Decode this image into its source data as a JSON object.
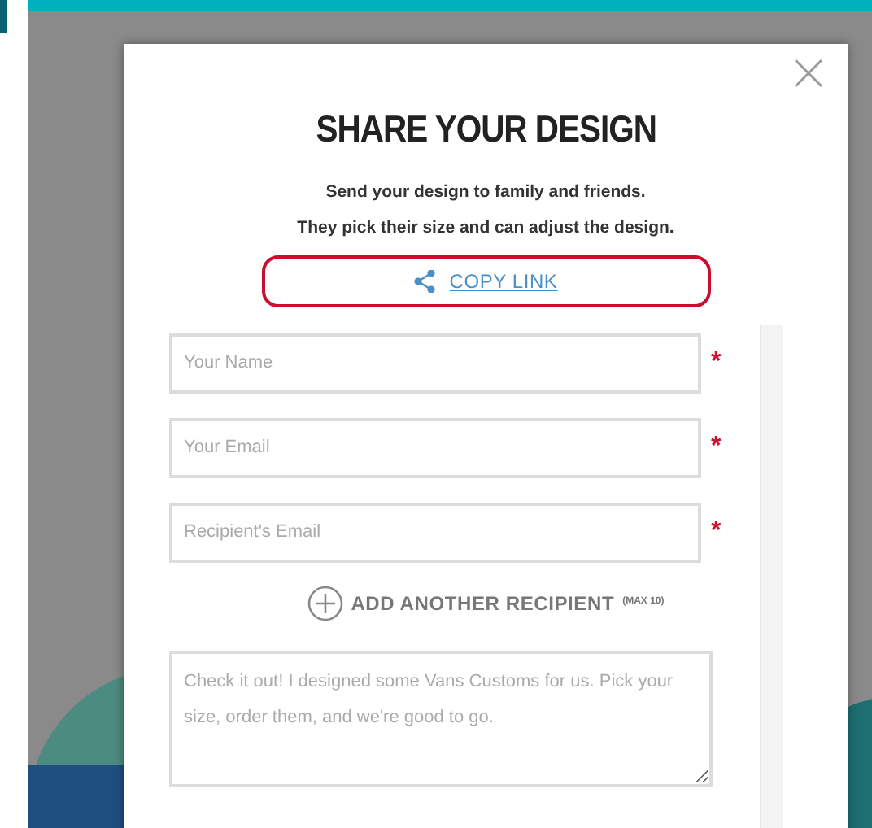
{
  "dialog": {
    "title": "SHARE YOUR DESIGN",
    "subtitle_lines": [
      "Send your design to family and friends.",
      "They pick their size and can adjust the design."
    ],
    "copy_link": {
      "label": "COPY LINK",
      "highlighted": true
    },
    "fields": [
      {
        "placeholder": "Your Name",
        "required": true
      },
      {
        "placeholder": "Your Email",
        "required": true
      },
      {
        "placeholder": "Recipient's Email",
        "required": true
      }
    ],
    "required_mark": "*",
    "add_recipient": {
      "label": "ADD ANOTHER RECIPIENT",
      "note": "(MAX 10)"
    },
    "message": {
      "placeholder": "Check it out! I designed some Vans Customs for us. Pick your size, order them, and we're good to go."
    }
  }
}
